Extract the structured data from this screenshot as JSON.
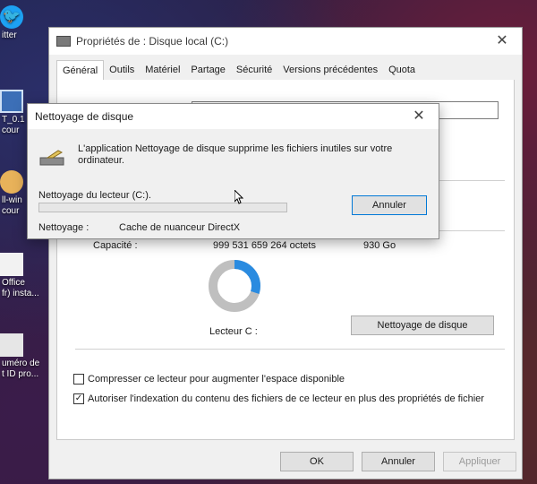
{
  "desktop": {
    "icons": [
      {
        "label": "itter",
        "icon": "twitter-icon"
      },
      {
        "label": "T_0.1\ncour",
        "icon": "computer-icon"
      },
      {
        "label": "ll-win\ncour",
        "icon": "face-icon"
      },
      {
        "label": "Office\nfr) insta...",
        "icon": "office-icon"
      },
      {
        "label": "uméro de\nt ID pro...",
        "icon": "document-icon"
      }
    ]
  },
  "properties": {
    "title": "Propriétés de : Disque local (C:)",
    "tabs": [
      "Général",
      "Outils",
      "Matériel",
      "Partage",
      "Sécurité",
      "Versions précédentes",
      "Quota"
    ],
    "capacity_label": "Capacité :",
    "capacity_bytes": "999 531 659 264 octets",
    "capacity_go": "930 Go",
    "drive_label": "Lecteur C :",
    "cleanup_button": "Nettoyage de disque",
    "used_fraction": 0.3,
    "checkbox_compress": {
      "label": "Compresser ce lecteur pour augmenter l'espace disponible",
      "checked": false
    },
    "checkbox_index": {
      "label": "Autoriser l'indexation du contenu des fichiers de ce lecteur en plus des propriétés de fichier",
      "checked": true
    },
    "buttons": {
      "ok": "OK",
      "cancel": "Annuler",
      "apply": "Appliquer"
    }
  },
  "cleanup_dialog": {
    "title": "Nettoyage de disque",
    "description": "L'application Nettoyage de disque supprime les fichiers inutiles sur votre ordinateur.",
    "drive_progress_label": "Nettoyage du lecteur  (C:).",
    "progress": 0,
    "cancel_button": "Annuler",
    "cleaning_label": "Nettoyage :",
    "cleaning_item": "Cache de nuanceur DirectX"
  },
  "colors": {
    "donut_used": "#2a8be0",
    "donut_free": "#bfbfbf",
    "progress_fill": "#06b025",
    "focus_border": "#0078d7"
  }
}
